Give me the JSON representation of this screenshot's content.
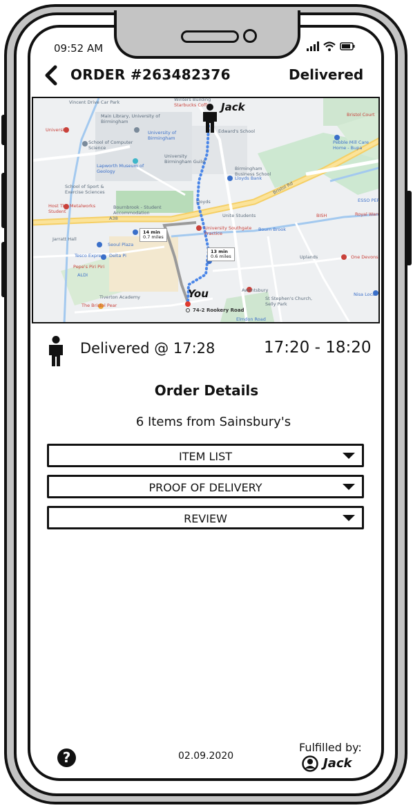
{
  "status_bar": {
    "time": "09:52 AM"
  },
  "header": {
    "title": "ORDER #263482376",
    "status": "Delivered"
  },
  "map": {
    "driver_name": "Jack",
    "you_label": "You",
    "destination": "74-2 Rookery Road",
    "walk_a": {
      "time": "14 min",
      "dist": "0.7 miles"
    },
    "walk_b": {
      "time": "13 min",
      "dist": "0.6 miles"
    },
    "labels": [
      "Vincent Drive Car Park",
      "Main Library, University of Birmingham",
      "Starbucks Coffee",
      "Winters Building",
      "University",
      "School of Computer Science",
      "University of Birmingham",
      "Edward's School",
      "Bristol Court",
      "Pebble Mill Care Home - Bupa",
      "Lapworth Museum of Geology",
      "University Birmingham Guild",
      "Birmingham Business School",
      "Lloyds Bank",
      "School of Sport & Exercise Sciences",
      "Bournbrook - Student Accommodation",
      "Host The Metalworks Student",
      "Unite Students",
      "ESSO PERSH",
      "Royal Warwick",
      "University Southgate Practice",
      "Bourn Brook",
      "Seoul Plaza",
      "Tesco Express",
      "Delta Pi",
      "Pepe's Piri Piri",
      "ALDI",
      "Uplands",
      "One Devonshire Place",
      "Tiverton Academy",
      "Awentsbury",
      "St Stephen's Church, Selly Park",
      "Nisa Local",
      "The Bristol Pear",
      "Elmdon Road",
      "Jarratt Hall",
      "A38",
      "Bristol Rd",
      "BISH",
      "Lloyds"
    ]
  },
  "delivery": {
    "label": "Delivered @ 17:28",
    "window": "17:20 - 18:20"
  },
  "order_details": {
    "title": "Order Details",
    "subtitle": "6 Items from Sainsbury's",
    "sections": [
      "ITEM LIST",
      "PROOF OF DELIVERY",
      "REVIEW"
    ]
  },
  "footer": {
    "help": "?",
    "date": "02.09.2020",
    "fulfilled_label": "Fulfilled by:",
    "fulfilled_name": "Jack"
  }
}
